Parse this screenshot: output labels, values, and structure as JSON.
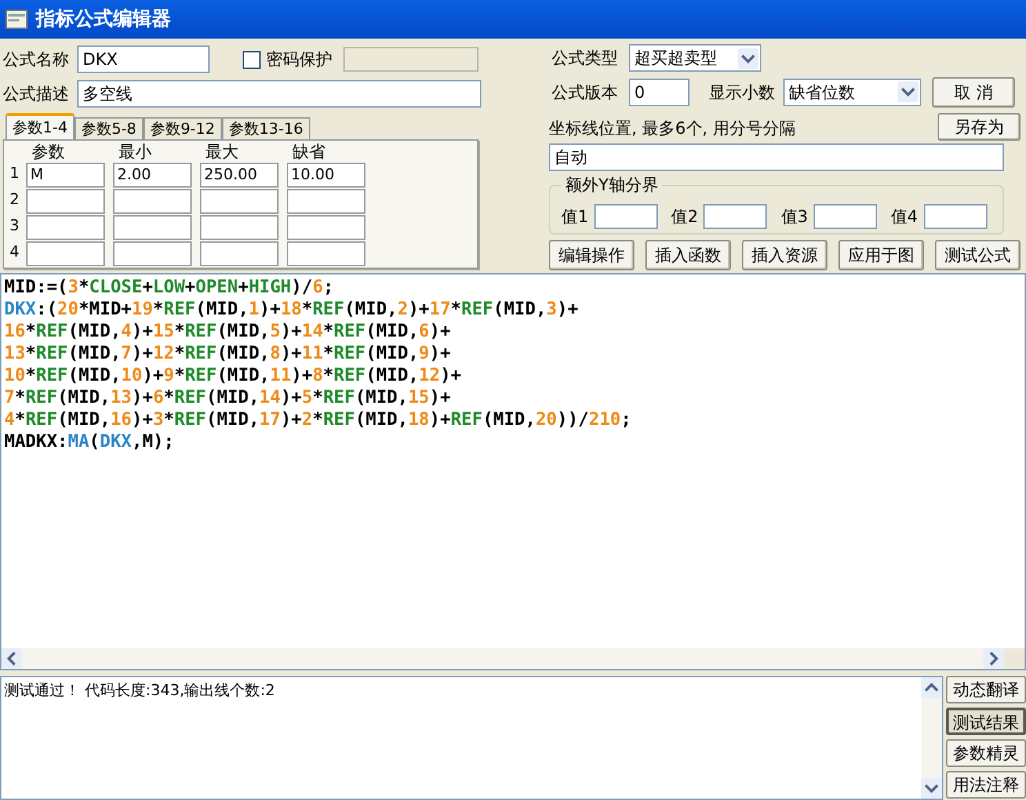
{
  "window": {
    "title": "指标公式编辑器"
  },
  "form": {
    "name_label": "公式名称",
    "name_value": "DKX",
    "password": {
      "label": "密码保护",
      "checked": false
    },
    "desc_label": "公式描述",
    "desc_value": "多空线",
    "type_label": "公式类型",
    "type_value": "超买超卖型",
    "version_label": "公式版本",
    "version_value": "0",
    "decimals_label": "显示小数",
    "decimals_value": "缺省位数"
  },
  "side_top_buttons": [
    "取 消",
    "另存为"
  ],
  "param_tabs": [
    {
      "label": "参数1-4",
      "selected": true
    },
    {
      "label": "参数5-8",
      "selected": false
    },
    {
      "label": "参数9-12",
      "selected": false
    },
    {
      "label": "参数13-16",
      "selected": false
    }
  ],
  "param_table": {
    "columns": [
      "参数",
      "最小",
      "最大",
      "缺省"
    ],
    "rows": [
      {
        "index": "1",
        "cells": [
          "M",
          "2.00",
          "250.00",
          "10.00"
        ]
      },
      {
        "index": "2"
      },
      {
        "index": "3"
      },
      {
        "index": "4"
      }
    ]
  },
  "axis_lines": {
    "label": "坐标线位置, 最多6个, 用分号分隔",
    "value": "自动"
  },
  "y_bounds": {
    "title": "额外Y轴分界",
    "fields": [
      "值1",
      "值2",
      "值3",
      "值4"
    ]
  },
  "actions": [
    "编辑操作",
    "插入函数",
    "插入资源",
    "应用于图",
    "测试公式"
  ],
  "code": [
    [
      {
        "kind": "p",
        "text": "MID:=("
      },
      {
        "kind": "n",
        "text": "3"
      },
      {
        "kind": "p",
        "text": "*"
      },
      {
        "kind": "f",
        "text": "CLOSE"
      },
      {
        "kind": "p",
        "text": "+"
      },
      {
        "kind": "f",
        "text": "LOW"
      },
      {
        "kind": "p",
        "text": "+"
      },
      {
        "kind": "f",
        "text": "OPEN"
      },
      {
        "kind": "p",
        "text": "+"
      },
      {
        "kind": "f",
        "text": "HIGH"
      },
      {
        "kind": "p",
        "text": ")/"
      },
      {
        "kind": "n",
        "text": "6"
      },
      {
        "kind": "p",
        "text": ";"
      }
    ],
    [
      {
        "kind": "v",
        "text": "DKX"
      },
      {
        "kind": "p",
        "text": ":("
      },
      {
        "kind": "n",
        "text": "20"
      },
      {
        "kind": "p",
        "text": "*MID+"
      },
      {
        "kind": "n",
        "text": "19"
      },
      {
        "kind": "p",
        "text": "*"
      },
      {
        "kind": "f",
        "text": "REF"
      },
      {
        "kind": "p",
        "text": "(MID,"
      },
      {
        "kind": "n",
        "text": "1"
      },
      {
        "kind": "p",
        "text": ")+"
      },
      {
        "kind": "n",
        "text": "18"
      },
      {
        "kind": "p",
        "text": "*"
      },
      {
        "kind": "f",
        "text": "REF"
      },
      {
        "kind": "p",
        "text": "(MID,"
      },
      {
        "kind": "n",
        "text": "2"
      },
      {
        "kind": "p",
        "text": ")+"
      },
      {
        "kind": "n",
        "text": "17"
      },
      {
        "kind": "p",
        "text": "*"
      },
      {
        "kind": "f",
        "text": "REF"
      },
      {
        "kind": "p",
        "text": "(MID,"
      },
      {
        "kind": "n",
        "text": "3"
      },
      {
        "kind": "p",
        "text": ")+"
      }
    ],
    [
      {
        "kind": "n",
        "text": "16"
      },
      {
        "kind": "p",
        "text": "*"
      },
      {
        "kind": "f",
        "text": "REF"
      },
      {
        "kind": "p",
        "text": "(MID,"
      },
      {
        "kind": "n",
        "text": "4"
      },
      {
        "kind": "p",
        "text": ")+"
      },
      {
        "kind": "n",
        "text": "15"
      },
      {
        "kind": "p",
        "text": "*"
      },
      {
        "kind": "f",
        "text": "REF"
      },
      {
        "kind": "p",
        "text": "(MID,"
      },
      {
        "kind": "n",
        "text": "5"
      },
      {
        "kind": "p",
        "text": ")+"
      },
      {
        "kind": "n",
        "text": "14"
      },
      {
        "kind": "p",
        "text": "*"
      },
      {
        "kind": "f",
        "text": "REF"
      },
      {
        "kind": "p",
        "text": "(MID,"
      },
      {
        "kind": "n",
        "text": "6"
      },
      {
        "kind": "p",
        "text": ")+"
      }
    ],
    [
      {
        "kind": "n",
        "text": "13"
      },
      {
        "kind": "p",
        "text": "*"
      },
      {
        "kind": "f",
        "text": "REF"
      },
      {
        "kind": "p",
        "text": "(MID,"
      },
      {
        "kind": "n",
        "text": "7"
      },
      {
        "kind": "p",
        "text": ")+"
      },
      {
        "kind": "n",
        "text": "12"
      },
      {
        "kind": "p",
        "text": "*"
      },
      {
        "kind": "f",
        "text": "REF"
      },
      {
        "kind": "p",
        "text": "(MID,"
      },
      {
        "kind": "n",
        "text": "8"
      },
      {
        "kind": "p",
        "text": ")+"
      },
      {
        "kind": "n",
        "text": "11"
      },
      {
        "kind": "p",
        "text": "*"
      },
      {
        "kind": "f",
        "text": "REF"
      },
      {
        "kind": "p",
        "text": "(MID,"
      },
      {
        "kind": "n",
        "text": "9"
      },
      {
        "kind": "p",
        "text": ")+"
      }
    ],
    [
      {
        "kind": "n",
        "text": "10"
      },
      {
        "kind": "p",
        "text": "*"
      },
      {
        "kind": "f",
        "text": "REF"
      },
      {
        "kind": "p",
        "text": "(MID,"
      },
      {
        "kind": "n",
        "text": "10"
      },
      {
        "kind": "p",
        "text": ")+"
      },
      {
        "kind": "n",
        "text": "9"
      },
      {
        "kind": "p",
        "text": "*"
      },
      {
        "kind": "f",
        "text": "REF"
      },
      {
        "kind": "p",
        "text": "(MID,"
      },
      {
        "kind": "n",
        "text": "11"
      },
      {
        "kind": "p",
        "text": ")+"
      },
      {
        "kind": "n",
        "text": "8"
      },
      {
        "kind": "p",
        "text": "*"
      },
      {
        "kind": "f",
        "text": "REF"
      },
      {
        "kind": "p",
        "text": "(MID,"
      },
      {
        "kind": "n",
        "text": "12"
      },
      {
        "kind": "p",
        "text": ")+"
      }
    ],
    [
      {
        "kind": "n",
        "text": "7"
      },
      {
        "kind": "p",
        "text": "*"
      },
      {
        "kind": "f",
        "text": "REF"
      },
      {
        "kind": "p",
        "text": "(MID,"
      },
      {
        "kind": "n",
        "text": "13"
      },
      {
        "kind": "p",
        "text": ")+"
      },
      {
        "kind": "n",
        "text": "6"
      },
      {
        "kind": "p",
        "text": "*"
      },
      {
        "kind": "f",
        "text": "REF"
      },
      {
        "kind": "p",
        "text": "(MID,"
      },
      {
        "kind": "n",
        "text": "14"
      },
      {
        "kind": "p",
        "text": ")+"
      },
      {
        "kind": "n",
        "text": "5"
      },
      {
        "kind": "p",
        "text": "*"
      },
      {
        "kind": "f",
        "text": "REF"
      },
      {
        "kind": "p",
        "text": "(MID,"
      },
      {
        "kind": "n",
        "text": "15"
      },
      {
        "kind": "p",
        "text": ")+"
      }
    ],
    [
      {
        "kind": "n",
        "text": "4"
      },
      {
        "kind": "p",
        "text": "*"
      },
      {
        "kind": "f",
        "text": "REF"
      },
      {
        "kind": "p",
        "text": "(MID,"
      },
      {
        "kind": "n",
        "text": "16"
      },
      {
        "kind": "p",
        "text": ")+"
      },
      {
        "kind": "n",
        "text": "3"
      },
      {
        "kind": "p",
        "text": "*"
      },
      {
        "kind": "f",
        "text": "REF"
      },
      {
        "kind": "p",
        "text": "(MID,"
      },
      {
        "kind": "n",
        "text": "17"
      },
      {
        "kind": "p",
        "text": ")+"
      },
      {
        "kind": "n",
        "text": "2"
      },
      {
        "kind": "p",
        "text": "*"
      },
      {
        "kind": "f",
        "text": "REF"
      },
      {
        "kind": "p",
        "text": "(MID,"
      },
      {
        "kind": "n",
        "text": "18"
      },
      {
        "kind": "p",
        "text": ")+"
      },
      {
        "kind": "f",
        "text": "REF"
      },
      {
        "kind": "p",
        "text": "(MID,"
      },
      {
        "kind": "n",
        "text": "20"
      },
      {
        "kind": "p",
        "text": "))/"
      },
      {
        "kind": "n",
        "text": "210"
      },
      {
        "kind": "p",
        "text": ";"
      }
    ],
    [
      {
        "kind": "p",
        "text": "MADKX:"
      },
      {
        "kind": "v",
        "text": "MA"
      },
      {
        "kind": "p",
        "text": "("
      },
      {
        "kind": "v",
        "text": "DKX"
      },
      {
        "kind": "p",
        "text": ",M);"
      }
    ]
  ],
  "output": "测试通过！ 代码长度:343,输出线个数:2",
  "side_buttons": [
    {
      "label": "动态翻译",
      "selected": false
    },
    {
      "label": "测试结果",
      "selected": true
    },
    {
      "label": "参数精灵",
      "selected": false
    },
    {
      "label": "用法注释",
      "selected": false
    }
  ]
}
